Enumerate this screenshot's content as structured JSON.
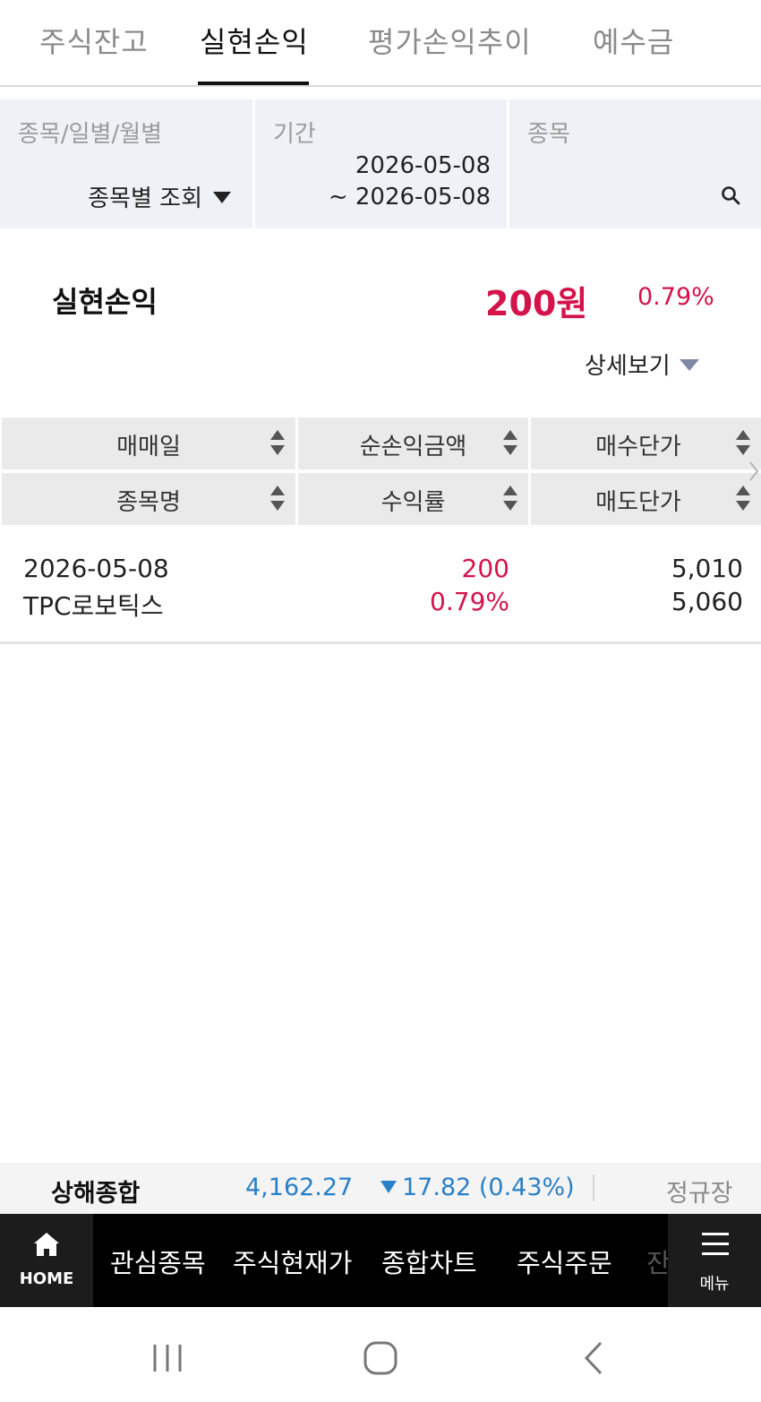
{
  "tabs": [
    {
      "label": "주식잔고",
      "active": false
    },
    {
      "label": "실현손익",
      "active": true
    },
    {
      "label": "평가손익추이",
      "active": false
    },
    {
      "label": "예수금",
      "active": false
    }
  ],
  "filters": {
    "mode_label": "종목/일별/월별",
    "mode_value": "종목별 조회",
    "period_label": "기간",
    "period_start": "2026-05-08",
    "period_end": "~ 2026-05-08",
    "stock_label": "종목"
  },
  "summary": {
    "label": "실현손익",
    "amount": "200원",
    "rate": "0.79%",
    "detail_label": "상세보기"
  },
  "table": {
    "headers_top": [
      "매매일",
      "순손익금액",
      "매수단가"
    ],
    "headers_bottom": [
      "종목명",
      "수익률",
      "매도단가"
    ],
    "rows": [
      {
        "date": "2026-05-08",
        "name": "TPC로보틱스",
        "net_profit": "200",
        "rate": "0.79%",
        "buy_price": "5,010",
        "sell_price": "5,060"
      }
    ]
  },
  "ticker": {
    "name": "상해종합",
    "price": "4,162.27",
    "change": "17.82 (0.43%)",
    "status": "정규장"
  },
  "appnav": {
    "home_label": "HOME",
    "items": [
      "관심종목",
      "주식현재가",
      "종합차트",
      "주식주문"
    ],
    "faded": "잔",
    "menu_label": "메뉴"
  },
  "colors": {
    "profit": "#d4134a",
    "index_down": "#2a80c8",
    "filter_bg": "#eef1f5"
  }
}
